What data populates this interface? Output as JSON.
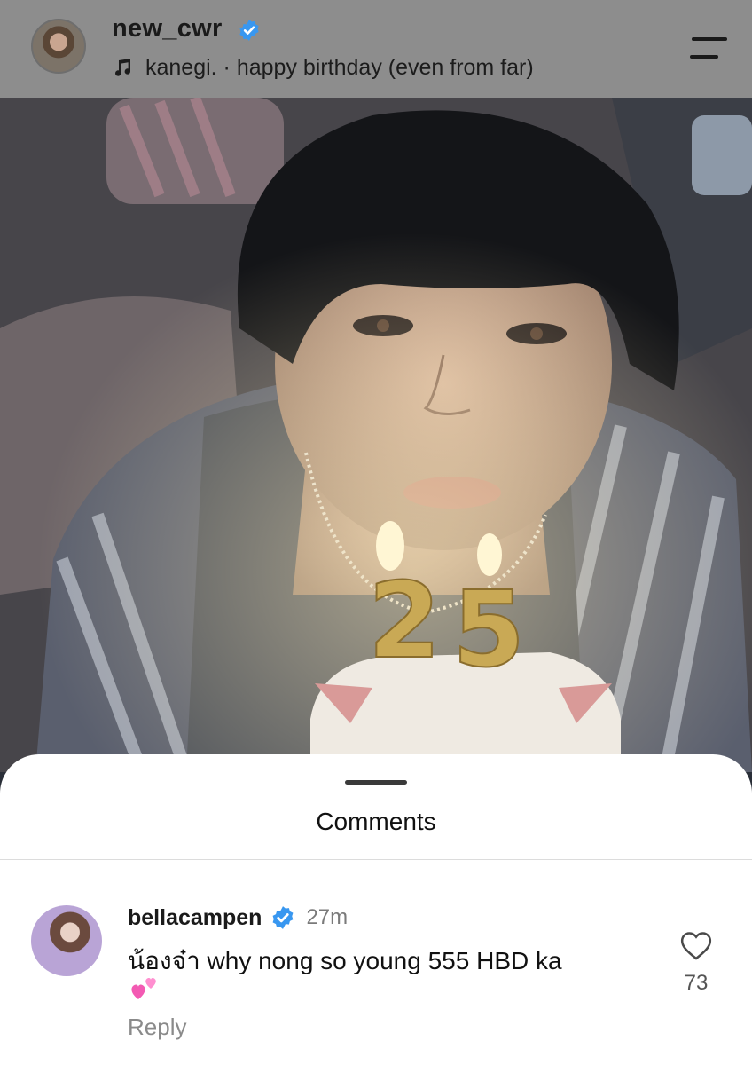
{
  "header": {
    "username": "new_cwr",
    "verified": true,
    "music_text": "kanegi. · happy birthday (even from far)",
    "icons": [
      "avatar",
      "verified-badge-icon",
      "music-note-icon",
      "menu-icon"
    ]
  },
  "photo": {
    "description_icon": "birthday-photo",
    "candle_number": "25"
  },
  "comments_sheet": {
    "title": "Comments",
    "comments": [
      {
        "username": "bellacampen",
        "verified": true,
        "time": "27m",
        "text": "น้องจ๋า why nong so young 555 HBD ka",
        "emoji": "💞",
        "reply_label": "Reply",
        "like_count": "73"
      }
    ]
  },
  "colors": {
    "header_bg": "#8d8d8d",
    "verified_blue": "#3897f0",
    "sheet_bg": "#ffffff"
  }
}
